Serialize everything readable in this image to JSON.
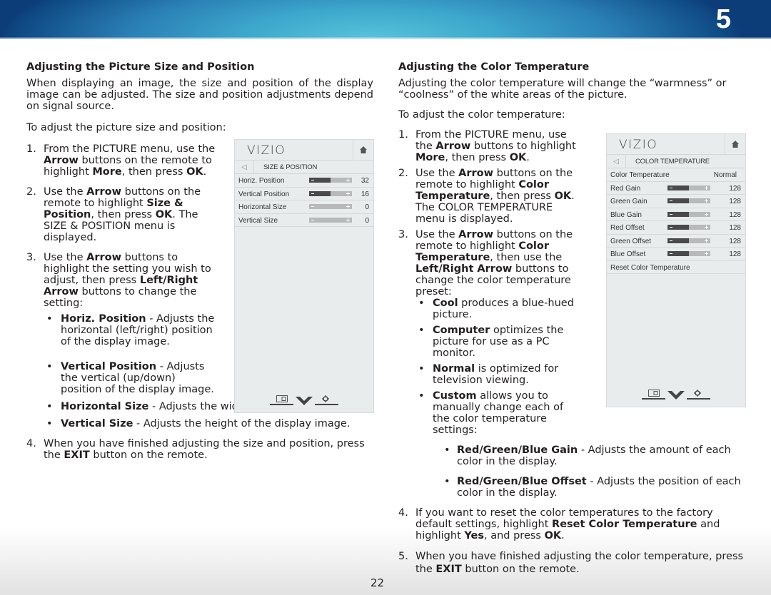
{
  "header": {
    "chapter_number": "5",
    "colors": {
      "accent_light": "#58c3da",
      "accent_dark": "#0c3d78"
    }
  },
  "left": {
    "heading": "Adjusting the Picture Size and Position",
    "intro": "When displaying an image, the size and position of the display image can be adjusted. The size and position adjustments depend on signal source.",
    "lead": "To adjust the picture size and position:",
    "steps": [
      {
        "num": "1.",
        "parts": [
          "From the PICTURE menu, use the ",
          "Arrow",
          " buttons on the remote to highlight ",
          "More",
          ", then press ",
          "OK",
          "."
        ]
      },
      {
        "num": "2.",
        "parts": [
          "Use the ",
          "Arrow",
          " buttons on the remote to highlight ",
          "Size & Position",
          ", then press ",
          "OK",
          ". The SIZE & POSITION menu is displayed."
        ]
      },
      {
        "num": "3.",
        "parts": [
          "Use the ",
          "Arrow",
          " buttons to highlight the setting you wish to adjust, then press ",
          "Left/Right Arrow",
          " buttons to change the setting:"
        ]
      },
      {
        "num": "4.",
        "parts": [
          "When you have finished adjusting the size and position, press the ",
          "EXIT",
          " button on the remote."
        ]
      }
    ],
    "bullets": [
      {
        "term": "Horiz. Position",
        "text": " - Adjusts the horizontal (left/right) position of the display image."
      },
      {
        "term": "Vertical Position",
        "text": " - Adjusts the vertical (up/down) position of the display image."
      },
      {
        "term": "Horizontal Size",
        "text": " - Adjusts the width of the display image."
      },
      {
        "term": "Vertical Size",
        "text": " - Adjusts the height of the display image."
      }
    ],
    "menu": {
      "logo": "VIZIO",
      "title": "SIZE & POSITION",
      "rows": [
        {
          "label": "Horiz. Position",
          "value": "32",
          "fill": 0.5
        },
        {
          "label": "Vertical Position",
          "value": "16",
          "fill": 0.5
        },
        {
          "label": "Horizontal Size",
          "value": "0",
          "fill": 0.0
        },
        {
          "label": "Vertical Size",
          "value": "0",
          "fill": 0.0
        }
      ]
    }
  },
  "right": {
    "heading": "Adjusting the Color Temperature",
    "intro": "Adjusting the color temperature will change the “warmness” or “coolness” of the white areas of the picture.",
    "lead": "To adjust the color temperature:",
    "steps": [
      {
        "num": "1.",
        "parts": [
          "From the PICTURE menu, use the ",
          "Arrow",
          " buttons to highlight ",
          "More",
          ", then press ",
          "OK",
          "."
        ]
      },
      {
        "num": "2.",
        "parts": [
          "Use the ",
          "Arrow",
          " buttons on the remote to highlight ",
          "Color Temperature",
          ", then press ",
          "OK",
          ". The COLOR TEMPERATURE menu is displayed."
        ]
      },
      {
        "num": "3.",
        "parts": [
          "Use the ",
          "Arrow",
          " buttons on the remote to highlight ",
          "Color Temperature",
          ", then use the ",
          "Left/Right Arrow",
          " buttons to change the color temperature preset:"
        ]
      },
      {
        "num": "4.",
        "parts": [
          "If you want to reset the color temperatures to the factory default settings, highlight ",
          "Reset Color Temperature",
          " and highlight ",
          "Yes",
          ", and press ",
          "OK",
          "."
        ]
      },
      {
        "num": "5.",
        "parts": [
          "When you have finished adjusting the color temperature, press the ",
          "EXIT",
          " button on the remote."
        ]
      }
    ],
    "presets": [
      {
        "term": "Cool",
        "text": " produces a blue-hued picture."
      },
      {
        "term": "Computer",
        "text": " optimizes the picture for use as a PC monitor."
      },
      {
        "term": "Normal",
        "text": " is optimized for television viewing."
      },
      {
        "term": "Custom",
        "text": " allows you to manually change each of the color temperature settings:"
      }
    ],
    "custom_items": [
      {
        "term": "Red/Green/Blue Gain",
        "text": " - Adjusts the amount of each color in the display."
      },
      {
        "term": "Red/Green/Blue Offset",
        "text": " - Adjusts the position of each color in the display."
      }
    ],
    "menu": {
      "logo": "VIZIO",
      "title": "COLOR TEMPERATURE",
      "setting_label": "Color Temperature",
      "setting_value": "Normal",
      "rows": [
        {
          "label": "Red Gain",
          "value": "128",
          "fill": 0.5
        },
        {
          "label": "Green Gain",
          "value": "128",
          "fill": 0.5
        },
        {
          "label": "Blue Gain",
          "value": "128",
          "fill": 0.5
        },
        {
          "label": "Red Offset",
          "value": "128",
          "fill": 0.5
        },
        {
          "label": "Green Offset",
          "value": "128",
          "fill": 0.5
        },
        {
          "label": "Blue Offset",
          "value": "128",
          "fill": 0.5
        }
      ],
      "reset_label": "Reset Color Temperature"
    }
  },
  "footer": {
    "page_number": "22"
  }
}
